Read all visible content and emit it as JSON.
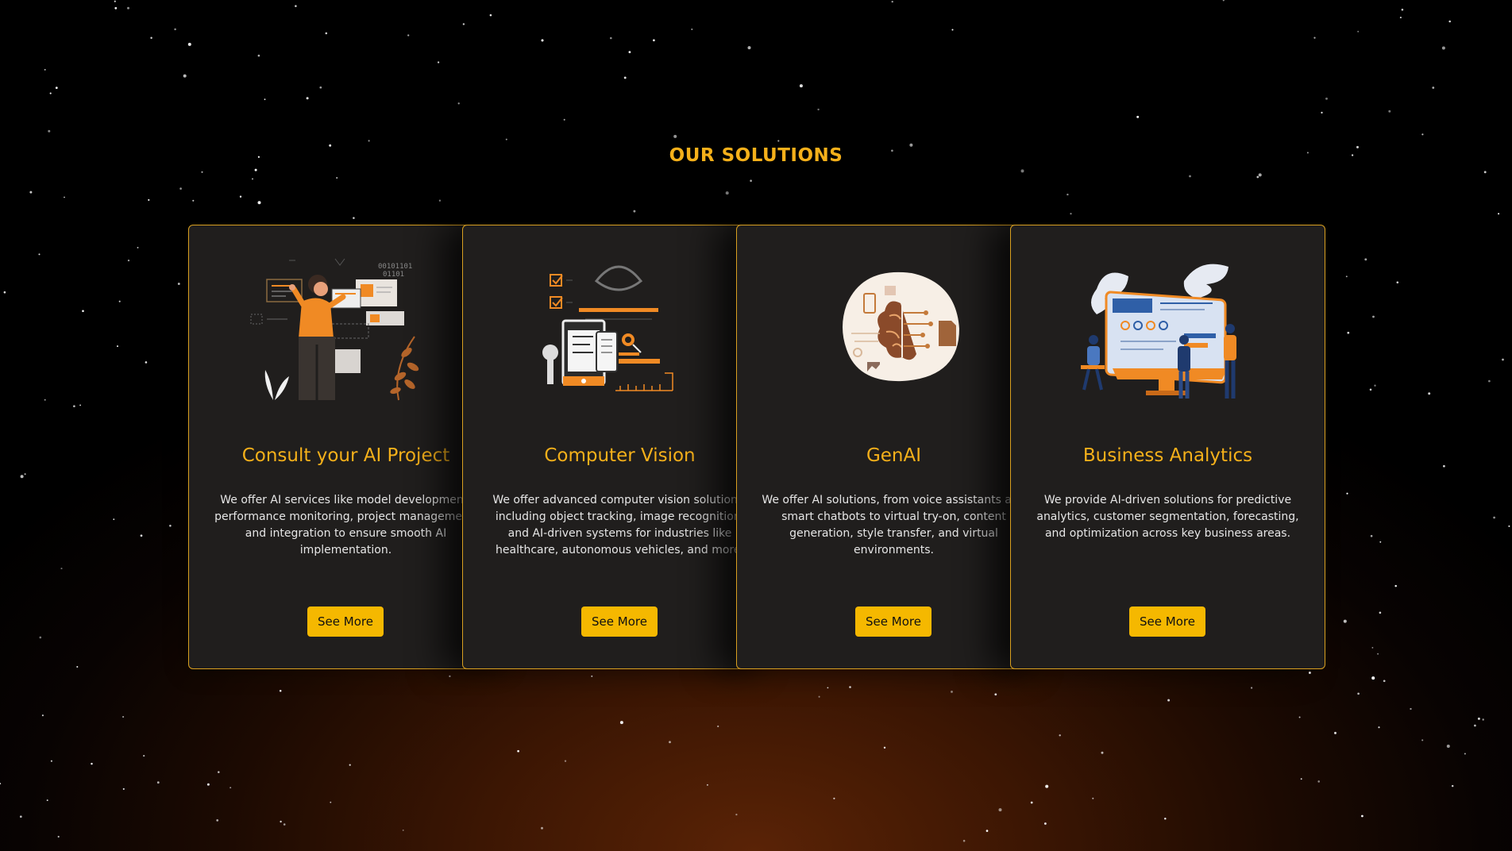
{
  "section": {
    "title": "OUR SOLUTIONS"
  },
  "colors": {
    "accent": "#f5b01a",
    "button": "#f5b800",
    "card": "#201e1d",
    "illustration_orange": "#f08a24"
  },
  "cards": [
    {
      "title": "Consult your AI Project",
      "description": "We offer AI services like model development, performance monitoring, project management, and integration to ensure smooth AI implementation.",
      "button": "See More",
      "icon": "consultant-whiteboard-illustration",
      "illustration_text": [
        "00101101",
        "01101"
      ]
    },
    {
      "title": "Computer Vision",
      "description": "We offer advanced computer vision solutions, including object tracking, image recognition, and AI-driven systems for industries like healthcare, autonomous vehicles, and more.",
      "button": "See More",
      "icon": "vision-devices-illustration"
    },
    {
      "title": "GenAI",
      "description": "We offer AI solutions, from voice assistants and smart chatbots to virtual try-on, content generation, style transfer, and virtual environments.",
      "button": "See More",
      "icon": "ai-brain-illustration"
    },
    {
      "title": "Business Analytics",
      "description": "We provide AI-driven solutions for predictive analytics, customer segmentation, forecasting, and optimization across key business areas.",
      "button": "See More",
      "icon": "analytics-dashboard-illustration"
    }
  ]
}
